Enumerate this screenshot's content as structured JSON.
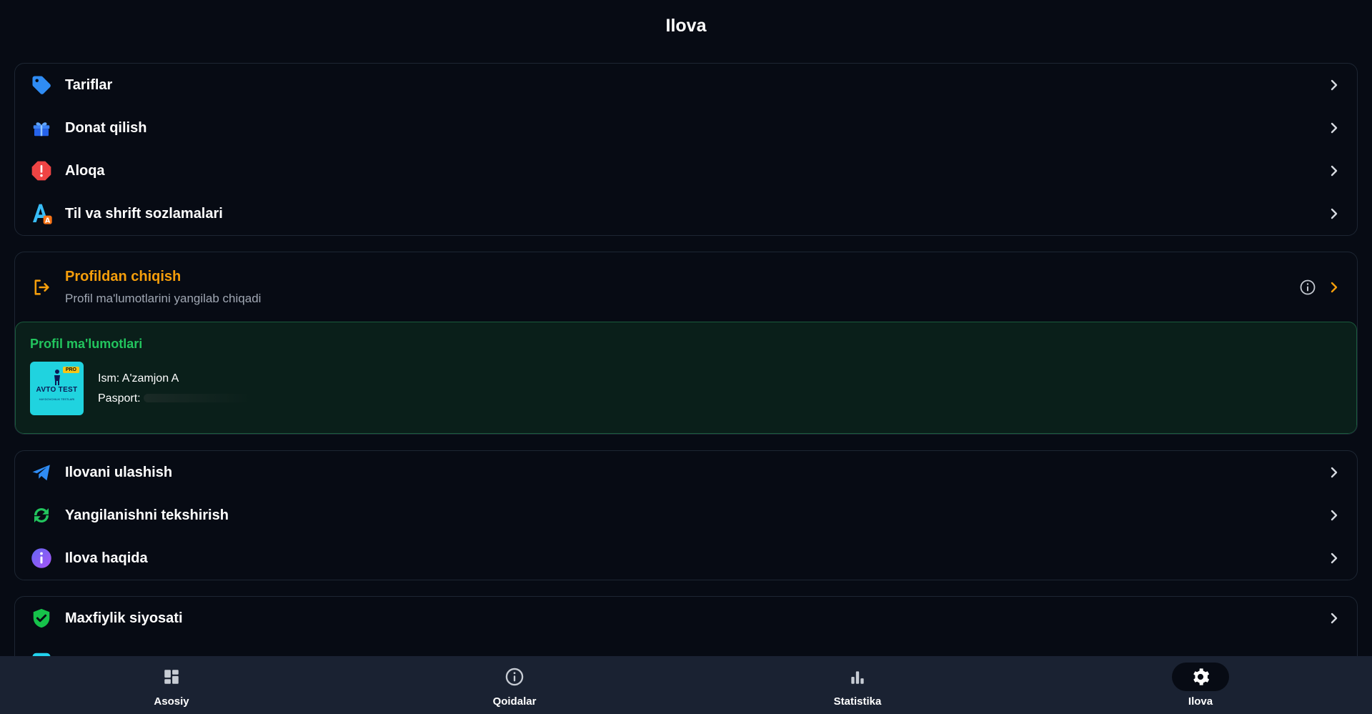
{
  "header": {
    "title": "Ilova"
  },
  "menu_group_1": [
    {
      "label": "Tariflar",
      "icon": "tag-icon"
    },
    {
      "label": "Donat qilish",
      "icon": "gift-icon"
    },
    {
      "label": "Aloqa",
      "icon": "alert-icon"
    },
    {
      "label": "Til va shrift sozlamalari",
      "icon": "font-language-icon"
    }
  ],
  "logout": {
    "title": "Profildan chiqish",
    "subtitle": "Profil ma'lumotlarini yangilab chiqadi",
    "color": "#f59e0b"
  },
  "profile": {
    "heading": "Profil ma'lumotlari",
    "name_line": "Ism: A'zamjon A",
    "passport_line": "Pasport:",
    "avatar": {
      "badge": "PRO",
      "brand": "AVTO TEST",
      "tagline": "HAYDOVCHILIK TESTLARI"
    },
    "accent": "#22c55e"
  },
  "menu_group_2": [
    {
      "label": "Ilovani ulashish",
      "icon": "telegram-icon"
    },
    {
      "label": "Yangilanishni tekshirish",
      "icon": "refresh-icon"
    },
    {
      "label": "Ilova haqida",
      "icon": "info-icon"
    }
  ],
  "menu_group_3": [
    {
      "label": "Maxfiylik siyosati",
      "icon": "shield-check-icon"
    }
  ],
  "bottom_nav": [
    {
      "label": "Asosiy",
      "icon": "dashboard-icon",
      "active": false
    },
    {
      "label": "Qoidalar",
      "icon": "info-circle-icon",
      "active": false
    },
    {
      "label": "Statistika",
      "icon": "bar-chart-icon",
      "active": false
    },
    {
      "label": "Ilova",
      "icon": "gear-icon",
      "active": true
    }
  ]
}
